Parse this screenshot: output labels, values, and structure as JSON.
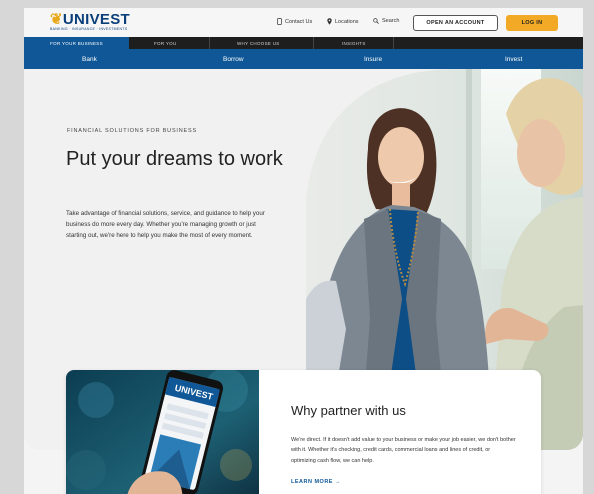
{
  "brand": {
    "logo_text": "UNIVEST",
    "tagline": "BANKING · INSURANCE · INVESTMENTS"
  },
  "utility_nav": {
    "contact": "Contact Us",
    "locations": "Locations",
    "search": "Search",
    "open_account": "OPEN AN ACCOUNT",
    "login": "LOG IN"
  },
  "primary_nav": [
    {
      "label": "FOR YOUR BUSINESS",
      "active": true
    },
    {
      "label": "FOR YOU",
      "active": false
    },
    {
      "label": "WHY CHOOSE US",
      "active": false
    },
    {
      "label": "INSIGHTS",
      "active": false
    }
  ],
  "secondary_nav": [
    "Bank",
    "Borrow",
    "Insure",
    "Invest"
  ],
  "hero": {
    "eyebrow": "FINANCIAL SOLUTIONS FOR BUSINESS",
    "headline": "Put your dreams to work",
    "body": "Take advantage of financial solutions, service, and guidance to help your business do more every day. Whether you're managing growth or just starting out, we're here to help you make the most of every moment."
  },
  "feature_card": {
    "title": "Why partner with us",
    "body": "We're direct. If it doesn't add value to your business or make your job easier, we don't bother with it. Whether it's checking, credit cards, commercial loans and lines of credit, or optimizing cash flow, we can help.",
    "link": "LEARN MORE →",
    "phone_logo": "UNIVEST"
  },
  "colors": {
    "brand_blue": "#0f5796",
    "accent_gold": "#f2a925",
    "nav_dark": "#1e1e1e"
  }
}
